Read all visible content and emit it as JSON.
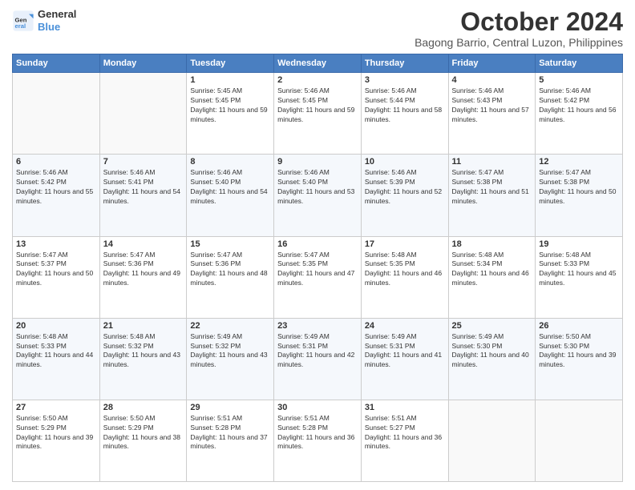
{
  "header": {
    "logo_line1": "General",
    "logo_line2": "Blue",
    "month": "October 2024",
    "location": "Bagong Barrio, Central Luzon, Philippines"
  },
  "days_of_week": [
    "Sunday",
    "Monday",
    "Tuesday",
    "Wednesday",
    "Thursday",
    "Friday",
    "Saturday"
  ],
  "weeks": [
    [
      {
        "day": "",
        "sunrise": "",
        "sunset": "",
        "daylight": ""
      },
      {
        "day": "",
        "sunrise": "",
        "sunset": "",
        "daylight": ""
      },
      {
        "day": "1",
        "sunrise": "Sunrise: 5:45 AM",
        "sunset": "Sunset: 5:45 PM",
        "daylight": "Daylight: 11 hours and 59 minutes."
      },
      {
        "day": "2",
        "sunrise": "Sunrise: 5:46 AM",
        "sunset": "Sunset: 5:45 PM",
        "daylight": "Daylight: 11 hours and 59 minutes."
      },
      {
        "day": "3",
        "sunrise": "Sunrise: 5:46 AM",
        "sunset": "Sunset: 5:44 PM",
        "daylight": "Daylight: 11 hours and 58 minutes."
      },
      {
        "day": "4",
        "sunrise": "Sunrise: 5:46 AM",
        "sunset": "Sunset: 5:43 PM",
        "daylight": "Daylight: 11 hours and 57 minutes."
      },
      {
        "day": "5",
        "sunrise": "Sunrise: 5:46 AM",
        "sunset": "Sunset: 5:42 PM",
        "daylight": "Daylight: 11 hours and 56 minutes."
      }
    ],
    [
      {
        "day": "6",
        "sunrise": "Sunrise: 5:46 AM",
        "sunset": "Sunset: 5:42 PM",
        "daylight": "Daylight: 11 hours and 55 minutes."
      },
      {
        "day": "7",
        "sunrise": "Sunrise: 5:46 AM",
        "sunset": "Sunset: 5:41 PM",
        "daylight": "Daylight: 11 hours and 54 minutes."
      },
      {
        "day": "8",
        "sunrise": "Sunrise: 5:46 AM",
        "sunset": "Sunset: 5:40 PM",
        "daylight": "Daylight: 11 hours and 54 minutes."
      },
      {
        "day": "9",
        "sunrise": "Sunrise: 5:46 AM",
        "sunset": "Sunset: 5:40 PM",
        "daylight": "Daylight: 11 hours and 53 minutes."
      },
      {
        "day": "10",
        "sunrise": "Sunrise: 5:46 AM",
        "sunset": "Sunset: 5:39 PM",
        "daylight": "Daylight: 11 hours and 52 minutes."
      },
      {
        "day": "11",
        "sunrise": "Sunrise: 5:47 AM",
        "sunset": "Sunset: 5:38 PM",
        "daylight": "Daylight: 11 hours and 51 minutes."
      },
      {
        "day": "12",
        "sunrise": "Sunrise: 5:47 AM",
        "sunset": "Sunset: 5:38 PM",
        "daylight": "Daylight: 11 hours and 50 minutes."
      }
    ],
    [
      {
        "day": "13",
        "sunrise": "Sunrise: 5:47 AM",
        "sunset": "Sunset: 5:37 PM",
        "daylight": "Daylight: 11 hours and 50 minutes."
      },
      {
        "day": "14",
        "sunrise": "Sunrise: 5:47 AM",
        "sunset": "Sunset: 5:36 PM",
        "daylight": "Daylight: 11 hours and 49 minutes."
      },
      {
        "day": "15",
        "sunrise": "Sunrise: 5:47 AM",
        "sunset": "Sunset: 5:36 PM",
        "daylight": "Daylight: 11 hours and 48 minutes."
      },
      {
        "day": "16",
        "sunrise": "Sunrise: 5:47 AM",
        "sunset": "Sunset: 5:35 PM",
        "daylight": "Daylight: 11 hours and 47 minutes."
      },
      {
        "day": "17",
        "sunrise": "Sunrise: 5:48 AM",
        "sunset": "Sunset: 5:35 PM",
        "daylight": "Daylight: 11 hours and 46 minutes."
      },
      {
        "day": "18",
        "sunrise": "Sunrise: 5:48 AM",
        "sunset": "Sunset: 5:34 PM",
        "daylight": "Daylight: 11 hours and 46 minutes."
      },
      {
        "day": "19",
        "sunrise": "Sunrise: 5:48 AM",
        "sunset": "Sunset: 5:33 PM",
        "daylight": "Daylight: 11 hours and 45 minutes."
      }
    ],
    [
      {
        "day": "20",
        "sunrise": "Sunrise: 5:48 AM",
        "sunset": "Sunset: 5:33 PM",
        "daylight": "Daylight: 11 hours and 44 minutes."
      },
      {
        "day": "21",
        "sunrise": "Sunrise: 5:48 AM",
        "sunset": "Sunset: 5:32 PM",
        "daylight": "Daylight: 11 hours and 43 minutes."
      },
      {
        "day": "22",
        "sunrise": "Sunrise: 5:49 AM",
        "sunset": "Sunset: 5:32 PM",
        "daylight": "Daylight: 11 hours and 43 minutes."
      },
      {
        "day": "23",
        "sunrise": "Sunrise: 5:49 AM",
        "sunset": "Sunset: 5:31 PM",
        "daylight": "Daylight: 11 hours and 42 minutes."
      },
      {
        "day": "24",
        "sunrise": "Sunrise: 5:49 AM",
        "sunset": "Sunset: 5:31 PM",
        "daylight": "Daylight: 11 hours and 41 minutes."
      },
      {
        "day": "25",
        "sunrise": "Sunrise: 5:49 AM",
        "sunset": "Sunset: 5:30 PM",
        "daylight": "Daylight: 11 hours and 40 minutes."
      },
      {
        "day": "26",
        "sunrise": "Sunrise: 5:50 AM",
        "sunset": "Sunset: 5:30 PM",
        "daylight": "Daylight: 11 hours and 39 minutes."
      }
    ],
    [
      {
        "day": "27",
        "sunrise": "Sunrise: 5:50 AM",
        "sunset": "Sunset: 5:29 PM",
        "daylight": "Daylight: 11 hours and 39 minutes."
      },
      {
        "day": "28",
        "sunrise": "Sunrise: 5:50 AM",
        "sunset": "Sunset: 5:29 PM",
        "daylight": "Daylight: 11 hours and 38 minutes."
      },
      {
        "day": "29",
        "sunrise": "Sunrise: 5:51 AM",
        "sunset": "Sunset: 5:28 PM",
        "daylight": "Daylight: 11 hours and 37 minutes."
      },
      {
        "day": "30",
        "sunrise": "Sunrise: 5:51 AM",
        "sunset": "Sunset: 5:28 PM",
        "daylight": "Daylight: 11 hours and 36 minutes."
      },
      {
        "day": "31",
        "sunrise": "Sunrise: 5:51 AM",
        "sunset": "Sunset: 5:27 PM",
        "daylight": "Daylight: 11 hours and 36 minutes."
      },
      {
        "day": "",
        "sunrise": "",
        "sunset": "",
        "daylight": ""
      },
      {
        "day": "",
        "sunrise": "",
        "sunset": "",
        "daylight": ""
      }
    ]
  ]
}
